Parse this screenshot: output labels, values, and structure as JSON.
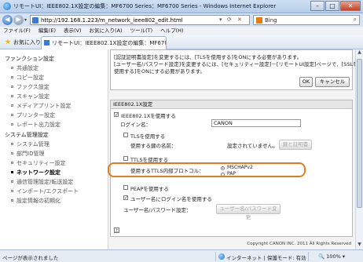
{
  "browser": {
    "window_title": "リモートUI：IEEE802.1X設定の編集：MF6700 Series：MF6700 Series - Windows Internet Explorer",
    "url": "http://192.168.1.223/m_network_ieee802_edit.html",
    "search_engine": "Bing",
    "menu": [
      "ファイル(F)",
      "編集(E)",
      "表示(V)",
      "お気に入り(A)",
      "ツール(T)",
      "ヘルプ(H)"
    ],
    "favorites_label": "お気に入り",
    "tab_title": "リモートUI：IEEE802.1X設定の編集：MF670..."
  },
  "sidebar": {
    "sections": [
      {
        "heading": "ファンクション設定",
        "items": [
          "共通設定",
          "コピー設定",
          "ファクス設定",
          "スキャン設定",
          "メディアプリント設定",
          "プリンター設定",
          "レポート出力設定"
        ]
      },
      {
        "heading": "システム管理設定",
        "items": [
          "システム管理",
          "部門ID管理",
          "セキュリティー設定",
          "ネットワーク設定",
          "通信管理設定/転送設定",
          "インポート/エクスポート",
          "設定情報の初期化"
        ]
      }
    ],
    "active_item": "ネットワーク設定"
  },
  "message": {
    "lines": [
      "[認証証明書設定]を変更するには、[TLSを使用する]をONにする必要があります。",
      "[ユーザー名/パスワード設定]を変更するには、[セキュリティー設定]－[リモートUI設定]ページで、[SSLを",
      "使用する]をONにする必要があります。"
    ],
    "ok_label": "OK",
    "cancel_label": "キャンセル"
  },
  "ieee": {
    "panel_title": "IEEE802.1X設定",
    "use_ieee_label": "IEEE802.1Xを使用する",
    "use_ieee_checked": true,
    "login_label": "ログイン名：",
    "login_value": "CANON",
    "tls_label": "TLSを使用する",
    "tls_checked": false,
    "cert_label": "使用する鍵の名前：",
    "cert_value": "設定されていません。",
    "cert_button": "鍵と証明書",
    "ttls_label": "TTLSを使用する",
    "ttls_checked": false,
    "ttls_protocol_label": "使用するTTLS内部プロトコル：",
    "ttls_options": [
      "MSCHAPv2",
      "PAP"
    ],
    "ttls_selected": "MSCHAPv2",
    "peap_label": "PEAPを使用する",
    "peap_checked": false,
    "same_user_label": "ユーザー名にログイン名を使用する",
    "same_user_checked": true,
    "userpass_label": "ユーザー名/パスワード設定：",
    "userpass_button": "ユーザー名/パスワード変更"
  },
  "top_link_glyph": "上",
  "copyright": "Copyright CANON INC. 2011 All Rights Reserved",
  "statusbar": {
    "left_text": "ページが表示されました",
    "zone_text": "インターネット | 保護モード: 有効",
    "zoom_text": "100%"
  },
  "colors": {
    "callout": "#e07c1a",
    "active_nav": "#000000"
  }
}
